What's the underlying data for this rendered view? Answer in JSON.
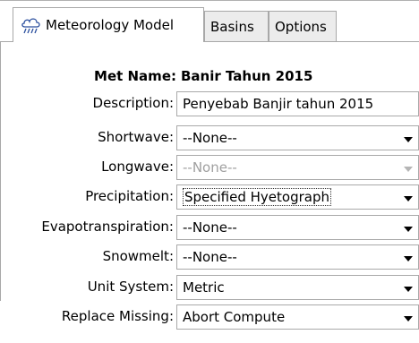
{
  "tabs": [
    {
      "label": "Meteorology Model",
      "icon": "meteorology-icon",
      "active": true
    },
    {
      "label": "Basins",
      "active": false
    },
    {
      "label": "Options",
      "active": false
    }
  ],
  "met_name": {
    "label": "Met Name:",
    "value": "Banir Tahun 2015"
  },
  "fields": {
    "description": {
      "label": "Description:",
      "value": "Penyebab Banjir tahun 2015"
    },
    "shortwave": {
      "label": "Shortwave:",
      "value": "--None--"
    },
    "longwave": {
      "label": "Longwave:",
      "value": "--None--"
    },
    "precipitation": {
      "label": "Precipitation:",
      "value": "Specified Hyetograph"
    },
    "evapotranspiration": {
      "label": "Evapotranspiration:",
      "value": "--None--"
    },
    "snowmelt": {
      "label": "Snowmelt:",
      "value": "--None--"
    },
    "unit_system": {
      "label": "Unit System:",
      "value": "Metric"
    },
    "replace_missing": {
      "label": "Replace Missing:",
      "value": "Abort Compute"
    }
  },
  "colors": {
    "border": "#a9a9a9",
    "tab_inactive": "#ececec",
    "disabled_text": "#a0a0a0"
  }
}
